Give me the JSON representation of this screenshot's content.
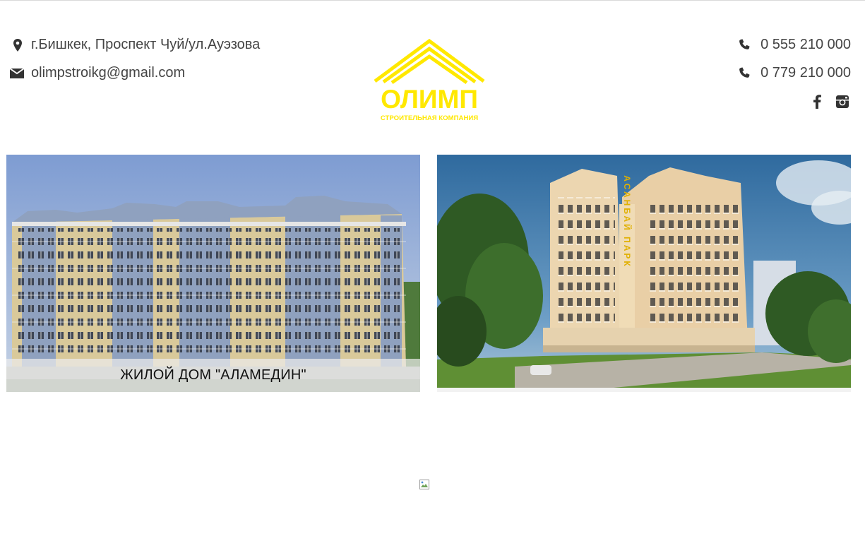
{
  "header": {
    "address": "г.Бишкек, Проспект Чуй/ул.Ауэзова",
    "email": "olimpstroikg@gmail.com",
    "phones": [
      "0 555 210 000",
      "0 779 210 000"
    ],
    "icons": {
      "address": "map-marker-icon",
      "email": "envelope-icon",
      "phone": "phone-icon",
      "social": [
        "facebook-icon",
        "instagram-icon"
      ]
    }
  },
  "logo": {
    "name": "ОЛИМП",
    "tagline": "СТРОИТЕЛЬНАЯ КОМПАНИЯ",
    "color": "#ffe800"
  },
  "projects": [
    {
      "caption": "ЖИЛОЙ ДОМ \"АЛАМЕДИН\""
    },
    {
      "caption": "",
      "sign": "АСАНБАЙ ПАРК"
    }
  ],
  "colors": {
    "text": "#444444",
    "accent": "#ffe800"
  }
}
